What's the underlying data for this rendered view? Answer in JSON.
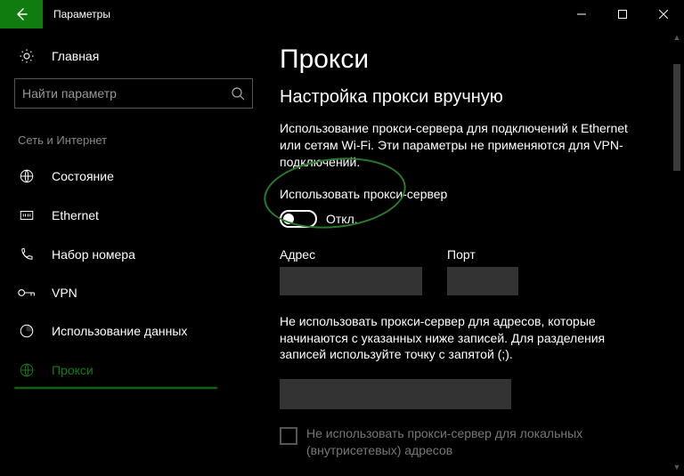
{
  "titlebar": {
    "title": "Параметры"
  },
  "sidebar": {
    "home": "Главная",
    "search_placeholder": "Найти параметр",
    "group": "Сеть и Интернет",
    "items": [
      {
        "label": "Состояние",
        "icon": "globe"
      },
      {
        "label": "Ethernet",
        "icon": "ethernet"
      },
      {
        "label": "Набор номера",
        "icon": "dial"
      },
      {
        "label": "VPN",
        "icon": "vpn"
      },
      {
        "label": "Использование данных",
        "icon": "datausage"
      },
      {
        "label": "Прокси",
        "icon": "globe",
        "active": true
      }
    ]
  },
  "main": {
    "h1": "Прокси",
    "h2": "Настройка прокси вручную",
    "desc": "Использование прокси-сервера для подключений к Ethernet или сетям Wi-Fi. Эти параметры не применяются для VPN-подключений.",
    "toggle_label": "Использовать прокси-сервер",
    "toggle_state": "Откл.",
    "addr_label": "Адрес",
    "addr_value": "",
    "port_label": "Порт",
    "port_value": "",
    "exceptions_desc": "Не использовать прокси-сервер для адресов, которые начинаются с указанных ниже записей. Для разделения записей используйте точку с запятой (;).",
    "exceptions_value": "",
    "local_chk": "Не использовать прокси-сервер для локальных (внутрисетевых) адресов"
  }
}
